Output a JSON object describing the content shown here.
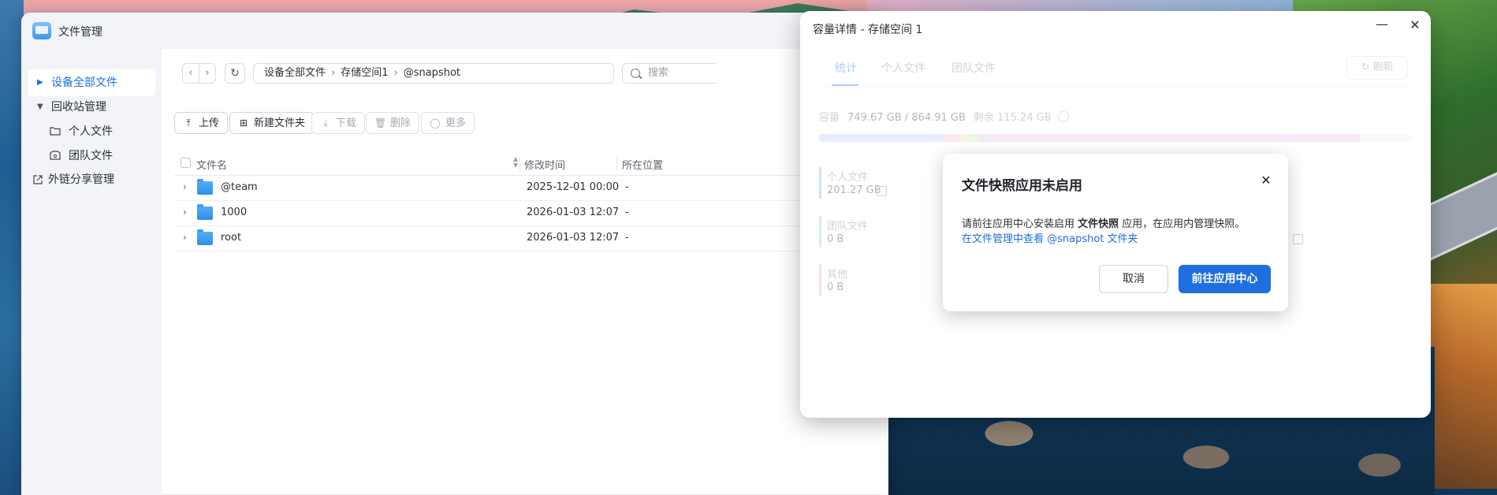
{
  "file_manager": {
    "title": "文件管理",
    "sidebar": {
      "items": [
        {
          "label": "设备全部文件",
          "active": true
        },
        {
          "label": "回收站管理"
        },
        {
          "label": "个人文件"
        },
        {
          "label": "团队文件"
        },
        {
          "label": "外链分享管理"
        }
      ]
    },
    "breadcrumb": [
      "设备全部文件",
      "存储空间1",
      "@snapshot"
    ],
    "search": {
      "placeholder": "搜索"
    },
    "toolbar": {
      "upload": "上传",
      "new_folder": "新建文件夹",
      "download": "下载",
      "delete": "删除",
      "more": "更多"
    },
    "table": {
      "headers": {
        "name": "文件名",
        "modified": "修改时间",
        "location": "所在位置"
      },
      "rows": [
        {
          "name": "@team",
          "modified": "2025-12-01 00:00",
          "location": "-"
        },
        {
          "name": "1000",
          "modified": "2026-01-03 12:07",
          "location": "-"
        },
        {
          "name": "root",
          "modified": "2026-01-03 12:07",
          "location": "-"
        }
      ]
    }
  },
  "storage": {
    "title": "容量详情 - 存储空间 1",
    "tabs": [
      "统计",
      "个人文件",
      "团队文件"
    ],
    "refresh": "刷新",
    "capacity_label": "容量",
    "capacity_value": "749.67 GB / 864.91 GB",
    "remaining": "剩余 115.24 GB",
    "usage_bar_colors": [
      "#b7cdf1",
      "#f4c2c6",
      "#f7d9a9",
      "#cfe8b5",
      "#e8c3ea"
    ],
    "legend": [
      {
        "name": "个人文件",
        "value": "201.27 GB",
        "color": "#7aa8e6"
      },
      {
        "name": "团队文件",
        "value": "0 B",
        "color": "#8fd1b3"
      },
      {
        "name": "其他",
        "value": "0 B",
        "color": "#e7a2cc"
      }
    ]
  },
  "dialog": {
    "title": "文件快照应用未启用",
    "body_prefix": "请前往应用中心安装启用 ",
    "body_bold": "文件快照",
    "body_suffix": " 应用，在应用内管理快照。",
    "link": "在文件管理中查看 @snapshot 文件夹",
    "cancel": "取消",
    "confirm": "前往应用中心"
  }
}
